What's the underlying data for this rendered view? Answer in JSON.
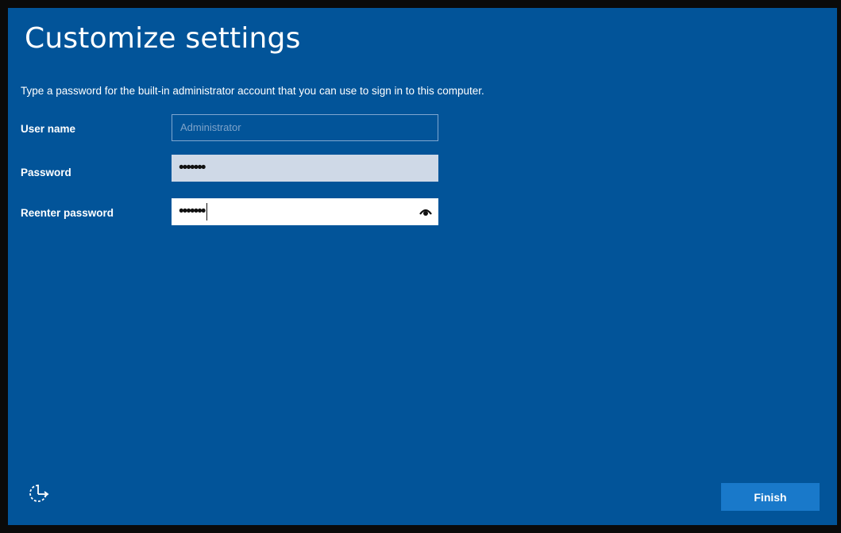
{
  "window": {
    "title": "Customize settings",
    "instruction": "Type a password for the built-in administrator account that you can use to sign in to this computer."
  },
  "form": {
    "username_label": "User name",
    "username_placeholder": "Administrator",
    "password_label": "Password",
    "password_value": "•••••••",
    "reenter_label": "Reenter password",
    "reenter_value": "•••••••"
  },
  "footer": {
    "ease_of_access_icon": "ease-of-access-icon",
    "finish_label": "Finish"
  },
  "colors": {
    "background": "#025499",
    "button": "#1979ca",
    "password_field": "#cfd9e7"
  }
}
